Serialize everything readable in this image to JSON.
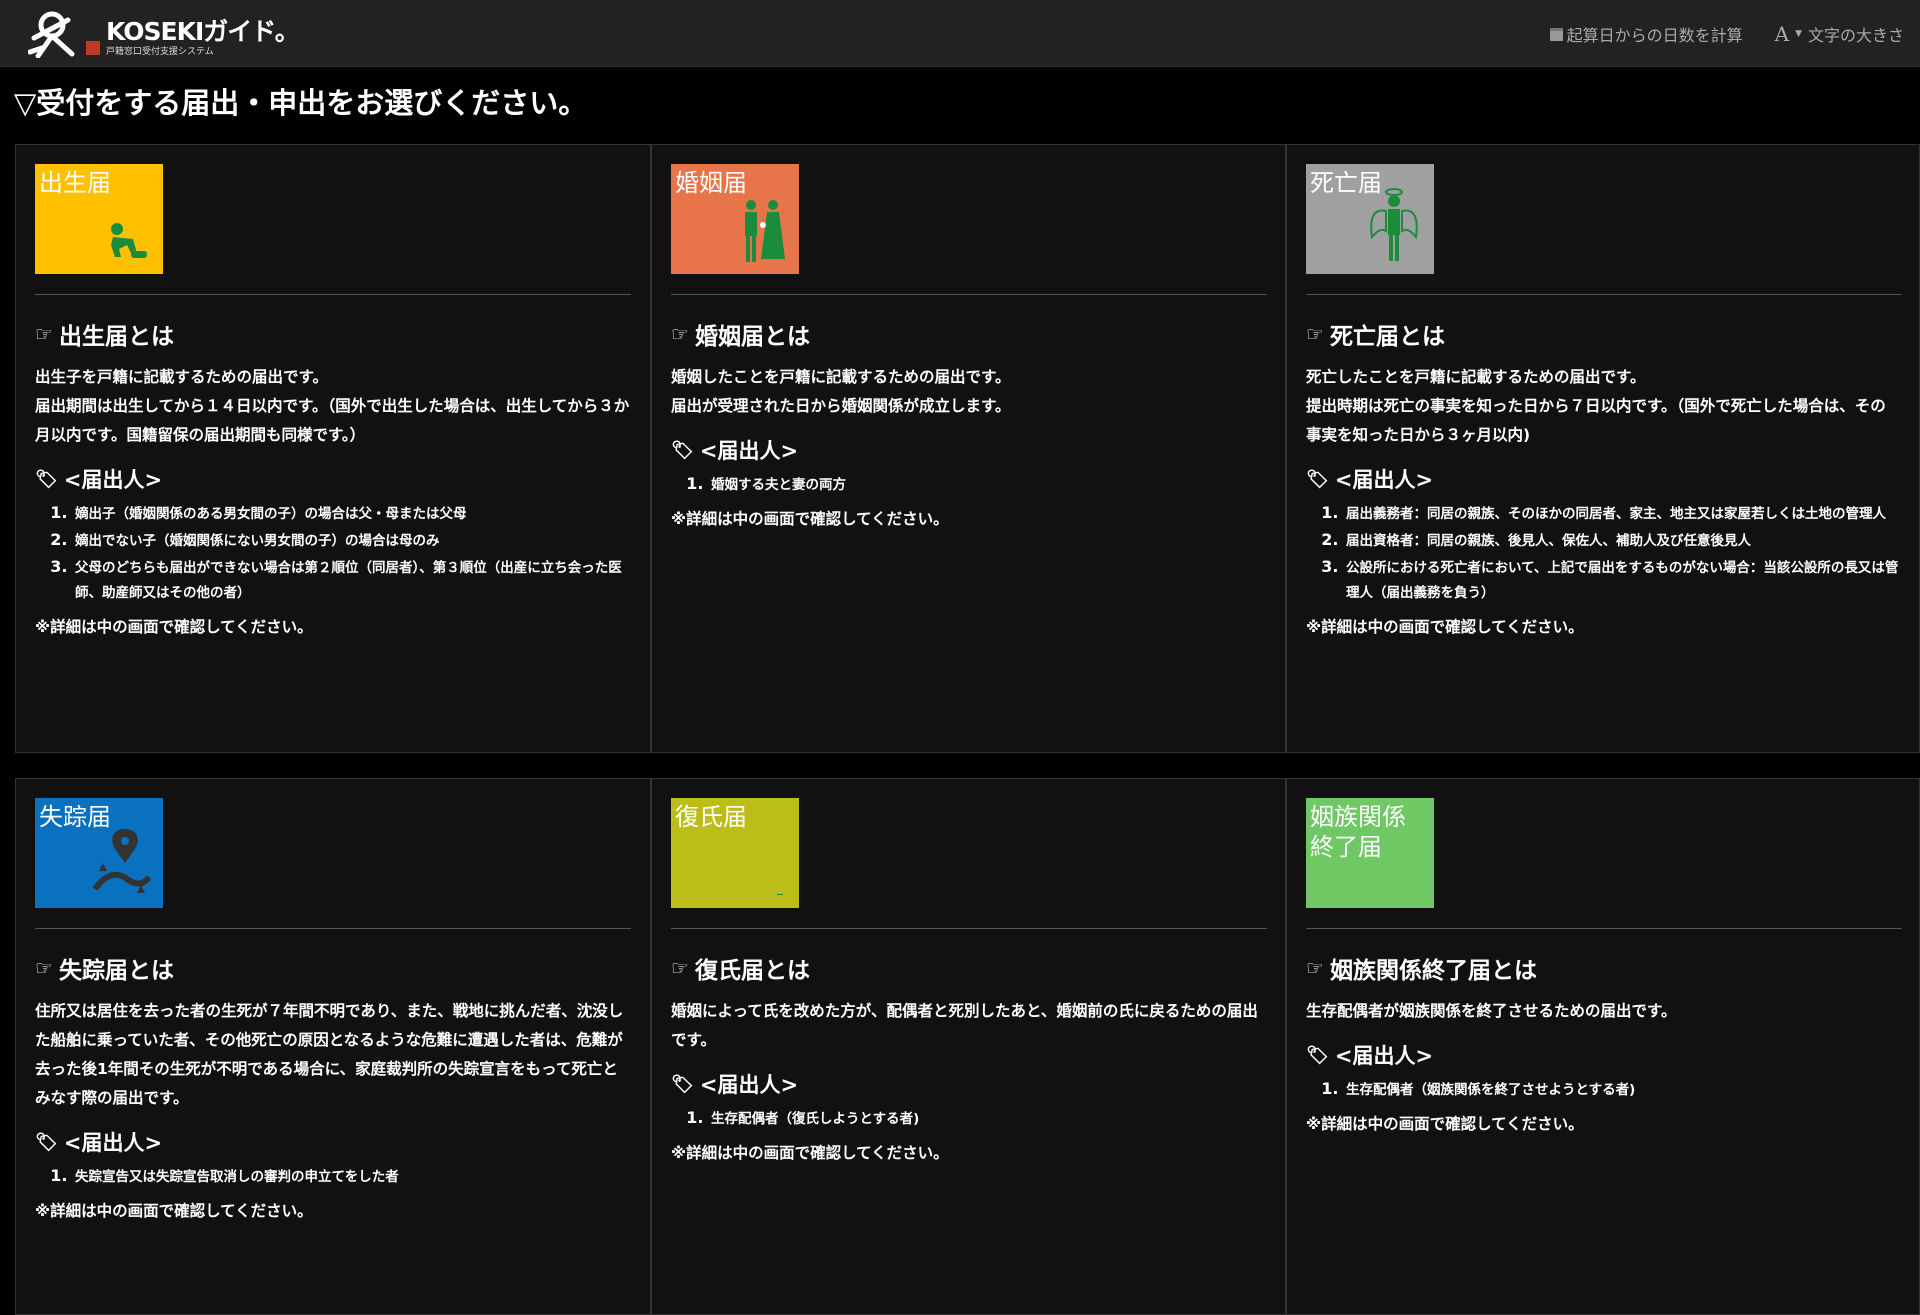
{
  "header": {
    "logo_title": "KOSEKIガイド。",
    "logo_sub": "戸籍窓口受付支援システム",
    "calc_days_label": "起算日からの日数を計算",
    "font_size_label": "文字の大きさ"
  },
  "page_heading": "▽受付をする届出・申出をお選びください。",
  "cards": [
    {
      "tile_label": "出生届",
      "tile_color": "#ffc000",
      "icon": "crawling-baby-icon",
      "title": "出生届とは",
      "desc": [
        "出生子を戸籍に記載するための届出です。",
        "届出期間は出生してから１４日以内です。（国外で出生した場合は、出生してから３か月以内です。国籍留保の届出期間も同様です。）"
      ],
      "applicant_heading": "<届出人>",
      "applicants": [
        "嫡出子（婚姻関係のある男女間の子）の場合は父・母または父母",
        "嫡出でない子（婚姻関係にない男女間の子）の場合は母のみ",
        "父母のどちらも届出ができない場合は第２順位（同居者）、第３順位（出産に立ち会った医師、助産師又はその他の者）"
      ],
      "note": "※詳細は中の画面で確認してください。"
    },
    {
      "tile_label": "婚姻届",
      "tile_color": "#e8754a",
      "icon": "bride-groom-icon",
      "title": "婚姻届とは",
      "desc": [
        "婚姻したことを戸籍に記載するための届出です。",
        "届出が受理された日から婚姻関係が成立します。"
      ],
      "applicant_heading": "<届出人>",
      "applicants": [
        "婚姻する夫と妻の両方"
      ],
      "note": "※詳細は中の画面で確認してください。"
    },
    {
      "tile_label": "死亡届",
      "tile_color": "#a0a0a0",
      "icon": "angel-icon",
      "title": "死亡届とは",
      "desc": [
        "死亡したことを戸籍に記載するための届出です。",
        "提出時期は死亡の事実を知った日から７日以内です。（国外で死亡した場合は、その事実を知った日から３ヶ月以内)"
      ],
      "applicant_heading": "<届出人>",
      "applicants": [
        "届出義務者：同居の親族、そのほかの同居者、家主、地主又は家屋若しくは土地の管理人",
        "届出資格者：同居の親族、後見人、保佐人、補助人及び任意後見人",
        "公設所における死亡者において、上記で届出をするものがない場合：当該公設所の長又は管理人（届出義務を負う）"
      ],
      "note": "※詳細は中の画面で確認してください。"
    },
    {
      "tile_label": "失踪届",
      "tile_color": "#0a70c0",
      "icon": "map-pin-path-icon",
      "title": "失踪届とは",
      "desc": [
        "住所又は居住を去った者の生死が７年間不明であり、また、戦地に挑んだ者、沈没した船舶に乗っていた者、その他死亡の原因となるような危難に遭遇した者は、危難が去った後1年間その生死が不明である場合に、家庭裁判所の失踪宣言をもって死亡とみなす際の届出です。"
      ],
      "applicant_heading": "<届出人>",
      "applicants": [
        "失踪宣告又は失踪宣告取消しの審判の申立てをした者"
      ],
      "note": "※詳細は中の画面で確認してください。"
    },
    {
      "tile_label": "復氏届",
      "tile_color": "#bdbd1a",
      "icon": "restore-name-icon",
      "title": "復氏届とは",
      "desc": [
        "婚姻によって氏を改めた方が、配偶者と死別したあと、婚姻前の氏に戻るための届出です。"
      ],
      "applicant_heading": "<届出人>",
      "applicants": [
        "生存配偶者（復氏しようとする者)"
      ],
      "note": "※詳細は中の画面で確認してください。"
    },
    {
      "tile_label": "姻族関係\n終了届",
      "tile_color": "#70c864",
      "icon": "family-end-icon",
      "title": "姻族関係終了届とは",
      "desc": [
        "生存配偶者が姻族関係を終了させるための届出です。"
      ],
      "applicant_heading": "<届出人>",
      "applicants": [
        "生存配偶者（姻族関係を終了させようとする者)"
      ],
      "note": "※詳細は中の画面で確認してください。"
    }
  ]
}
